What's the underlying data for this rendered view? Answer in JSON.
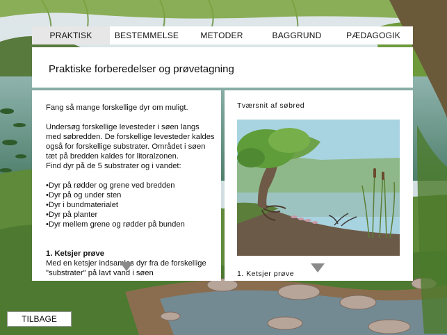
{
  "tabs": [
    {
      "label": "PRAKTISK",
      "active": true
    },
    {
      "label": "BESTEMMELSE",
      "active": false
    },
    {
      "label": "METODER",
      "active": false
    },
    {
      "label": "BAGGRUND",
      "active": false
    },
    {
      "label": "PÆDAGOGIK",
      "active": false
    }
  ],
  "page_title": "Praktiske forberedelser og prøvetagning",
  "left_panel": {
    "intro": "Fang så mange forskellige dyr om muligt.",
    "paragraph": "Undersøg forskellige levesteder i søen langs med søbredden. De forskellige levesteder kaldes også for forskellige substrater. Området i søen tæt på bredden kaldes for litoralzonen.",
    "find_line": "Find dyr på de 5 substrater og i vandet:",
    "list": [
      "•Dyr på rødder og grene ved bredden",
      "•Dyr på og under sten",
      "•Dyr i bundmaterialet",
      "•Dyr på planter",
      "•Dyr mellem grene og rødder på bunden"
    ],
    "section_heading": "1. Ketsjer prøve",
    "section_text": "Med en ketsjer indsamles dyr fra de forskellige \"substrater\" på lavt vand i søen"
  },
  "right_panel": {
    "caption": "Tværsnit af søbred",
    "sub_caption": "1. Ketsjer prøve"
  },
  "back_button": "TILBAGE",
  "colors": {
    "panel": "#ffffff",
    "active_tab": "#e7e7e7",
    "arrow": "#8a8a8a"
  }
}
